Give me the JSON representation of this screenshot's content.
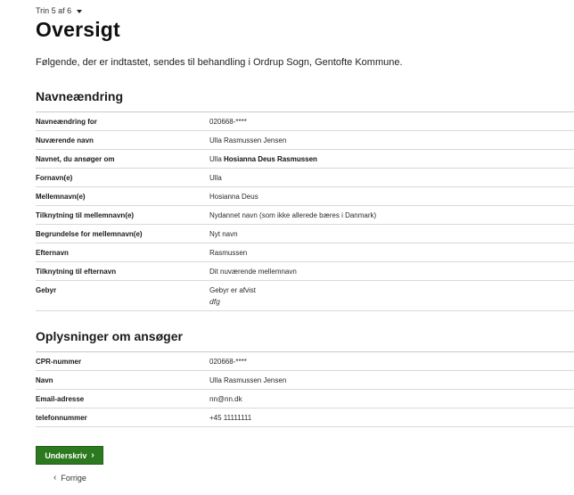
{
  "step": {
    "label": "Trin 5 af 6"
  },
  "page": {
    "title": "Oversigt",
    "intro": "Følgende, der er indtastet, sendes til behandling i Ordrup Sogn, Gentofte Kommune."
  },
  "name_change": {
    "title": "Navneændring",
    "rows": [
      {
        "label": "Navneændring for",
        "value": "020668-****"
      },
      {
        "label": "Nuværende navn",
        "value": "Ulla Rasmussen Jensen"
      },
      {
        "label": "Navnet, du ansøger om",
        "value_prefix": "Ulla ",
        "value_bold": "Hosianna Deus Rasmussen"
      },
      {
        "label": "Fornavn(e)",
        "value": "Ulla"
      },
      {
        "label": "Mellemnavn(e)",
        "value": "Hosianna Deus"
      },
      {
        "label": "Tilknytning til mellemnavn(e)",
        "value": "Nydannet navn (som ikke allerede bæres i Danmark)"
      },
      {
        "label": "Begrundelse for mellemnavn(e)",
        "value": "Nyt navn"
      },
      {
        "label": "Efternavn",
        "value": "Rasmussen"
      },
      {
        "label": "Tilknytning til efternavn",
        "value": "Dit nuværende mellemnavn"
      },
      {
        "label": "Gebyr",
        "value": "Gebyr er afvist",
        "note": "dfg"
      }
    ]
  },
  "applicant": {
    "title": "Oplysninger om ansøger",
    "rows": [
      {
        "label": "CPR-nummer",
        "value": "020668-****"
      },
      {
        "label": "Navn",
        "value": "Ulla Rasmussen Jensen"
      },
      {
        "label": "Email-adresse",
        "value": "nn@nn.dk"
      },
      {
        "label": "telefonnummer",
        "value": "+45 11111111"
      }
    ]
  },
  "actions": {
    "sign_label": "Underskriv",
    "back_label": "Forrige"
  },
  "icons": {
    "step_dropdown": "caret-down-icon",
    "sign": "chevron-right-icon",
    "back": "chevron-left-icon"
  },
  "colors": {
    "primary_button": "#2c7a1f",
    "text": "#1a1a1a",
    "row_divider": "#d9d9d9"
  }
}
